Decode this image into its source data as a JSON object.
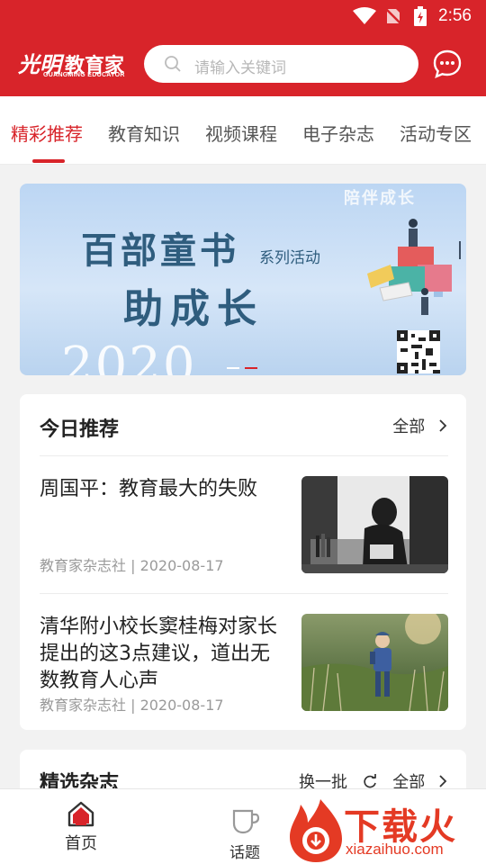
{
  "status_bar": {
    "time": "2:56"
  },
  "header": {
    "logo_cn": "教育家",
    "logo_script": "光明",
    "logo_en": "GUANGMING EDUCATOR",
    "search_placeholder": "请输入关键词"
  },
  "tabs": [
    {
      "label": "精彩推荐",
      "active": true
    },
    {
      "label": "教育知识"
    },
    {
      "label": "视频课程"
    },
    {
      "label": "电子杂志"
    },
    {
      "label": "活动专区"
    }
  ],
  "banner": {
    "line1": "百部童书",
    "series": "系列活动",
    "line2": "助成长",
    "year": "2020",
    "companion": "陪伴成长",
    "page_index": 2,
    "page_count": 2
  },
  "today": {
    "title": "今日推荐",
    "all_label": "全部",
    "articles": [
      {
        "title": "周国平：教育最大的失败",
        "meta": "教育家杂志社 | 2020-08-17"
      },
      {
        "title": "清华附小校长窦桂梅对家长提出的这3点建议，道出无数教育人心声",
        "meta": "教育家杂志社 | 2020-08-17"
      }
    ]
  },
  "magazines": {
    "title": "精选杂志",
    "swap_label": "换一批",
    "all_label": "全部"
  },
  "bottom_nav": [
    {
      "label": "首页",
      "active": true
    },
    {
      "label": "话题"
    }
  ],
  "watermark": {
    "text": "下载火",
    "url": "xiazaihuo.com"
  },
  "colors": {
    "brand_red": "#d8242a",
    "background": "#f2f2f2"
  }
}
